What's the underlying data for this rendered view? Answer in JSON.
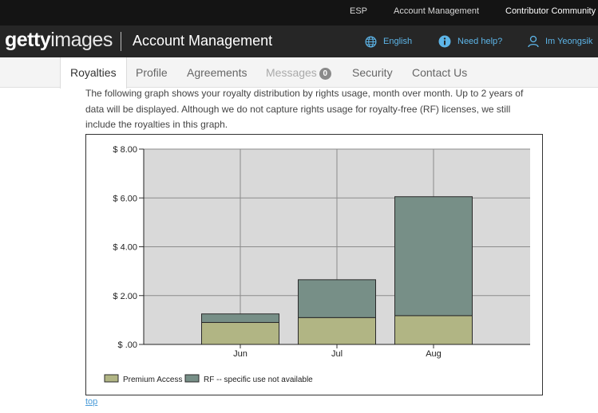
{
  "topbar": {
    "language": "ESP",
    "account_management": "Account Management",
    "contributor_community": "Contributor Community"
  },
  "header": {
    "logo_bold": "getty",
    "logo_light": "images",
    "title": "Account Management",
    "language_label": "English",
    "language_icon": "globe-icon",
    "help_label": "Need help?",
    "help_icon": "info-icon",
    "user_label": "Im Yeongsik",
    "user_icon": "user-icon",
    "accent_color": "#5db5e8"
  },
  "tabs": [
    {
      "label": "Royalties",
      "active": true
    },
    {
      "label": "Profile"
    },
    {
      "label": "Agreements"
    },
    {
      "label": "Messages",
      "badge": "0",
      "disabled": true
    },
    {
      "label": "Security"
    },
    {
      "label": "Contact Us"
    }
  ],
  "description": "The following graph shows your royalty distribution by rights usage, month over month. Up to 2 years of data will be displayed. Although we do not capture rights usage for royalty-free (RF) licenses, we still include the royalties in this graph.",
  "chart_data": {
    "type": "bar",
    "stacked": true,
    "categories": [
      "Jun",
      "Jul",
      "Aug"
    ],
    "series": [
      {
        "name": "Premium Access",
        "values": [
          0.9,
          1.1,
          1.18
        ],
        "color": "#b1b584"
      },
      {
        "name": "RF -- specific use not available",
        "values": [
          0.35,
          1.55,
          4.87
        ],
        "color": "#778f87"
      }
    ],
    "yticks": [
      "$ .00",
      "$ 2.00",
      "$ 4.00",
      "$ 6.00",
      "$ 8.00"
    ],
    "ylim": [
      0,
      8
    ],
    "grid": true,
    "legend_position": "bottom-left",
    "plot_background": "#d9d9d9"
  },
  "footer": {
    "top_link": "top"
  }
}
